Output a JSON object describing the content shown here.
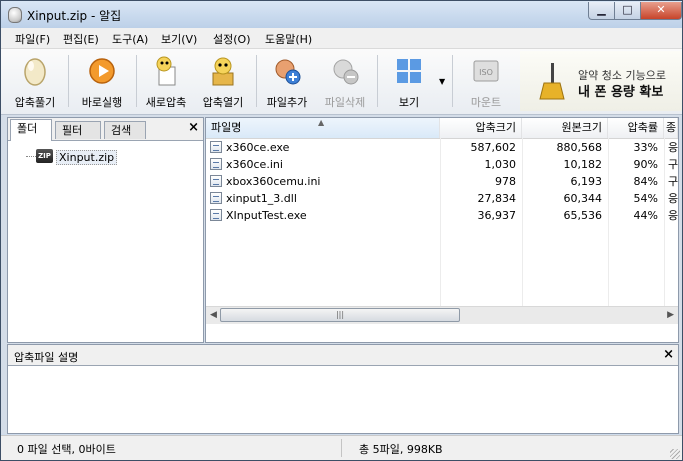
{
  "window": {
    "title": "Xinput.zip - 알집"
  },
  "menu": [
    "파일(F)",
    "편집(E)",
    "도구(A)",
    "보기(V)",
    "설정(O)",
    "도움말(H)"
  ],
  "toolbar": {
    "extract": "압축풀기",
    "run": "바로실행",
    "new_archive": "새로압축",
    "open_archive": "압축열기",
    "add_file": "파일추가",
    "delete_file": "파일삭제",
    "view": "보기",
    "mount": "마운트",
    "mount_badge": "ISO"
  },
  "ad": {
    "line1": "알약 청소 기능으로",
    "line2": "내 폰 용량 확보"
  },
  "left_panel": {
    "tabs": [
      "폴더",
      "필터",
      "검색"
    ],
    "close": "×",
    "tree_root": "Xinput.zip",
    "zip_badge": "ZIP"
  },
  "file_list": {
    "columns": [
      "파일명",
      "압축크기",
      "원본크기",
      "압축률",
      "종"
    ],
    "rows": [
      {
        "name": "x360ce.exe",
        "packed": "587,602",
        "original": "880,568",
        "ratio": "33%",
        "type": "응"
      },
      {
        "name": "x360ce.ini",
        "packed": "1,030",
        "original": "10,182",
        "ratio": "90%",
        "type": "구"
      },
      {
        "name": "xbox360cemu.ini",
        "packed": "978",
        "original": "6,193",
        "ratio": "84%",
        "type": "구"
      },
      {
        "name": "xinput1_3.dll",
        "packed": "27,834",
        "original": "60,344",
        "ratio": "54%",
        "type": "응"
      },
      {
        "name": "XInputTest.exe",
        "packed": "36,937",
        "original": "65,536",
        "ratio": "44%",
        "type": "응"
      }
    ]
  },
  "description": {
    "title": "압축파일 설명",
    "close": "×"
  },
  "status": {
    "left": "0 파일 선택,  0바이트",
    "right": "총 5파일,  998KB"
  }
}
